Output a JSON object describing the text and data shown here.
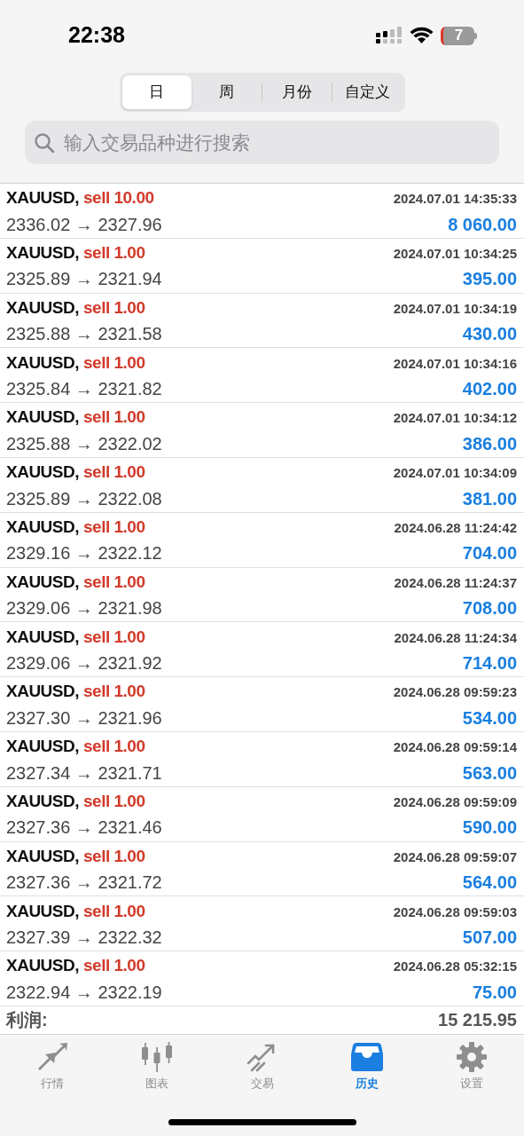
{
  "status_bar": {
    "time": "22:38",
    "battery": "7"
  },
  "period_tabs": [
    {
      "label": "日",
      "selected": true
    },
    {
      "label": "周",
      "selected": false
    },
    {
      "label": "月份",
      "selected": false
    },
    {
      "label": "自定义",
      "selected": false
    }
  ],
  "search": {
    "placeholder": "输入交易品种进行搜索"
  },
  "trades": [
    {
      "symbol": "XAUUSD,",
      "kind": "sell",
      "deal": "sell 10.00",
      "time": "2024.07.01 14:35:33",
      "prices": "2336.02 → 2327.96",
      "profit": "8 060.00"
    },
    {
      "symbol": "XAUUSD,",
      "kind": "sell",
      "deal": "sell 1.00",
      "time": "2024.07.01 10:34:25",
      "prices": "2325.89 → 2321.94",
      "profit": "395.00"
    },
    {
      "symbol": "XAUUSD,",
      "kind": "sell",
      "deal": "sell 1.00",
      "time": "2024.07.01 10:34:19",
      "prices": "2325.88 → 2321.58",
      "profit": "430.00"
    },
    {
      "symbol": "XAUUSD,",
      "kind": "sell",
      "deal": "sell 1.00",
      "time": "2024.07.01 10:34:16",
      "prices": "2325.84 → 2321.82",
      "profit": "402.00"
    },
    {
      "symbol": "XAUUSD,",
      "kind": "sell",
      "deal": "sell 1.00",
      "time": "2024.07.01 10:34:12",
      "prices": "2325.88 → 2322.02",
      "profit": "386.00"
    },
    {
      "symbol": "XAUUSD,",
      "kind": "sell",
      "deal": "sell 1.00",
      "time": "2024.07.01 10:34:09",
      "prices": "2325.89 → 2322.08",
      "profit": "381.00"
    },
    {
      "symbol": "XAUUSD,",
      "kind": "sell",
      "deal": "sell 1.00",
      "time": "2024.06.28 11:24:42",
      "prices": "2329.16 → 2322.12",
      "profit": "704.00"
    },
    {
      "symbol": "XAUUSD,",
      "kind": "sell",
      "deal": "sell 1.00",
      "time": "2024.06.28 11:24:37",
      "prices": "2329.06 → 2321.98",
      "profit": "708.00"
    },
    {
      "symbol": "XAUUSD,",
      "kind": "sell",
      "deal": "sell 1.00",
      "time": "2024.06.28 11:24:34",
      "prices": "2329.06 → 2321.92",
      "profit": "714.00"
    },
    {
      "symbol": "XAUUSD,",
      "kind": "sell",
      "deal": "sell 1.00",
      "time": "2024.06.28 09:59:23",
      "prices": "2327.30 → 2321.96",
      "profit": "534.00"
    },
    {
      "symbol": "XAUUSD,",
      "kind": "sell",
      "deal": "sell 1.00",
      "time": "2024.06.28 09:59:14",
      "prices": "2327.34 → 2321.71",
      "profit": "563.00"
    },
    {
      "symbol": "XAUUSD,",
      "kind": "sell",
      "deal": "sell 1.00",
      "time": "2024.06.28 09:59:09",
      "prices": "2327.36 → 2321.46",
      "profit": "590.00"
    },
    {
      "symbol": "XAUUSD,",
      "kind": "sell",
      "deal": "sell 1.00",
      "time": "2024.06.28 09:59:07",
      "prices": "2327.36 → 2321.72",
      "profit": "564.00"
    },
    {
      "symbol": "XAUUSD,",
      "kind": "sell",
      "deal": "sell 1.00",
      "time": "2024.06.28 09:59:03",
      "prices": "2327.39 → 2322.32",
      "profit": "507.00"
    },
    {
      "symbol": "XAUUSD,",
      "kind": "sell",
      "deal": "sell 1.00",
      "time": "2024.06.28 05:32:15",
      "prices": "2322.94 → 2322.19",
      "profit": "75.00"
    }
  ],
  "summary": {
    "label": "利润:",
    "value": "15 215.95"
  },
  "tab_bar": [
    {
      "label": "行情",
      "kind": "quotes",
      "selected": false
    },
    {
      "label": "图表",
      "kind": "chart",
      "selected": false
    },
    {
      "label": "交易",
      "kind": "trade",
      "selected": false
    },
    {
      "label": "历史",
      "kind": "history",
      "selected": true
    },
    {
      "label": "设置",
      "kind": "settings",
      "selected": false
    }
  ]
}
